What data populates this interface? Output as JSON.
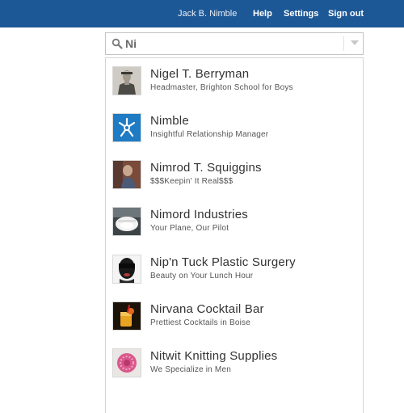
{
  "header": {
    "user_name": "Jack B. Nimble",
    "help_label": "Help",
    "settings_label": "Settings",
    "signout_label": "Sign out",
    "background_color": "#1d5896"
  },
  "search": {
    "query": "Ni",
    "icon": "search-icon",
    "dropdown_icon": "chevron-down-icon"
  },
  "results": [
    {
      "name": "Nigel T. Berryman",
      "subtitle": "Headmaster, Brighton School for Boys"
    },
    {
      "name": "Nimble",
      "subtitle": "Insightful Relationship Manager"
    },
    {
      "name": "Nimrod T. Squiggins",
      "subtitle": "$$$Keepin' It Real$$$"
    },
    {
      "name": "Nimord Industries",
      "subtitle": "Your Plane, Our Pilot"
    },
    {
      "name": "Nip'n Tuck Plastic Surgery",
      "subtitle": "Beauty on Your Lunch Hour"
    },
    {
      "name": "Nirvana Cocktail Bar",
      "subtitle": "Prettiest Cocktails in Boise"
    },
    {
      "name": "Nitwit Knitting Supplies",
      "subtitle": "We Specialize in Men"
    }
  ]
}
